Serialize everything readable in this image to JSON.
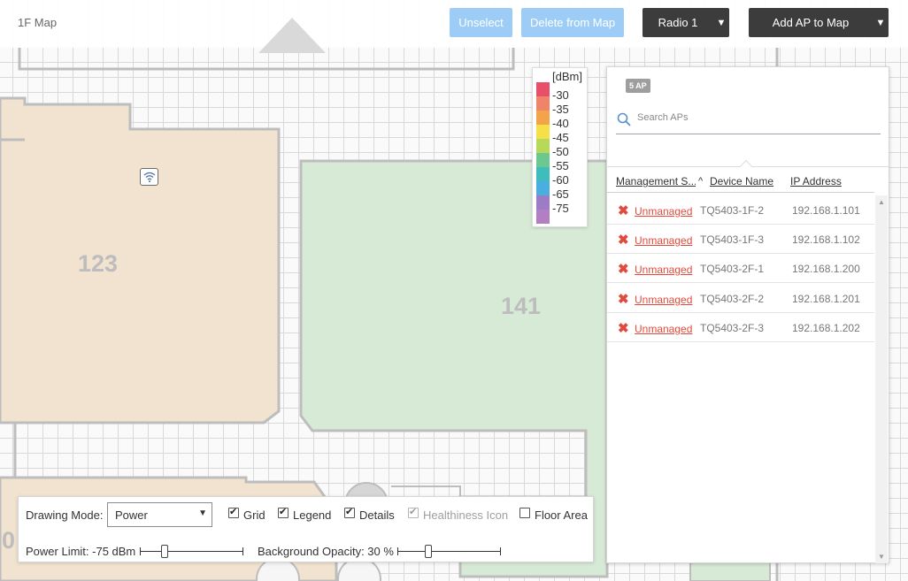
{
  "map": {
    "title": "1F Map",
    "rooms": [
      {
        "label": "123"
      },
      {
        "label": "141"
      },
      {
        "label": "0"
      }
    ]
  },
  "toolbar_top": {
    "unselect_label": "Unselect",
    "delete_label": "Delete from Map",
    "radio_label": "Radio 1",
    "add_ap_label": "Add AP to Map"
  },
  "legend": {
    "unit": "[dBm]",
    "entries": [
      {
        "value": "-30",
        "color": "#e8506a"
      },
      {
        "value": "-35",
        "color": "#f08468"
      },
      {
        "value": "-40",
        "color": "#f3a34a"
      },
      {
        "value": "-45",
        "color": "#f5e04a"
      },
      {
        "value": "-50",
        "color": "#b8d85a"
      },
      {
        "value": "-55",
        "color": "#6cc88f"
      },
      {
        "value": "-60",
        "color": "#3fbcbc"
      },
      {
        "value": "-65",
        "color": "#4aaee0"
      },
      {
        "value": "-75",
        "color": "#9c7cc4"
      },
      {
        "value": "",
        "color": "#b37fc3"
      }
    ]
  },
  "ap_panel": {
    "count_badge": "5 AP",
    "search_placeholder": "Search APs",
    "columns": {
      "management": "Management S...",
      "device": "Device Name",
      "ip": "IP Address"
    },
    "rows": [
      {
        "status": "Unmanaged",
        "device": "TQ5403-1F-2",
        "ip": "192.168.1.101"
      },
      {
        "status": "Unmanaged",
        "device": "TQ5403-1F-3",
        "ip": "192.168.1.102"
      },
      {
        "status": "Unmanaged",
        "device": "TQ5403-2F-1",
        "ip": "192.168.1.200"
      },
      {
        "status": "Unmanaged",
        "device": "TQ5403-2F-2",
        "ip": "192.168.1.201"
      },
      {
        "status": "Unmanaged",
        "device": "TQ5403-2F-3",
        "ip": "192.168.1.202"
      }
    ]
  },
  "toolbar_bottom": {
    "drawing_mode_label": "Drawing Mode:",
    "drawing_mode_value": "Power",
    "grid_label": "Grid",
    "grid_checked": true,
    "legend_label": "Legend",
    "legend_checked": true,
    "details_label": "Details",
    "details_checked": true,
    "healthiness_label": "Healthiness Icon",
    "healthiness_checked": true,
    "healthiness_disabled": true,
    "floor_area_label": "Floor Area",
    "floor_area_checked": false,
    "power_limit_label": "Power Limit: -75 dBm",
    "power_limit_position": 0.24,
    "opacity_label": "Background Opacity: 30 %",
    "opacity_position": 0.3
  },
  "colors": {
    "accent_light": "#9dcdf6",
    "dark_button": "#3c3c3c",
    "unmanaged_red": "#e24b3b",
    "room_beige": "#f1e3cf",
    "room_green": "#d7ead5"
  }
}
